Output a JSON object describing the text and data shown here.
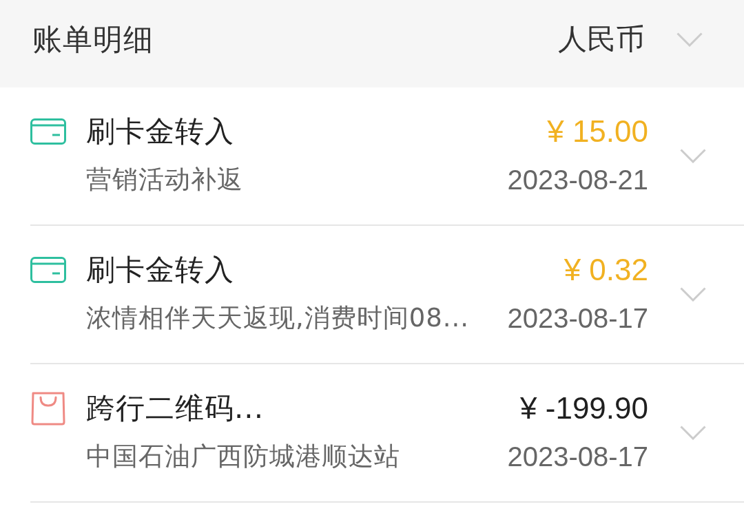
{
  "header": {
    "title": "账单明细",
    "currency": "人民币"
  },
  "transactions": [
    {
      "kind": "card",
      "title": "刷卡金转入",
      "description": "营销活动补返",
      "amount": "¥ 15.00",
      "date": "2023-08-21"
    },
    {
      "kind": "card",
      "title": "刷卡金转入",
      "description": "浓情相伴天天返现,消费时间08...",
      "amount": "¥ 0.32",
      "date": "2023-08-17"
    },
    {
      "kind": "purchase",
      "title": "跨行二维码...",
      "description": "中国石油广西防城港顺达站",
      "amount": "¥ -199.90",
      "date": "2023-08-17"
    }
  ]
}
